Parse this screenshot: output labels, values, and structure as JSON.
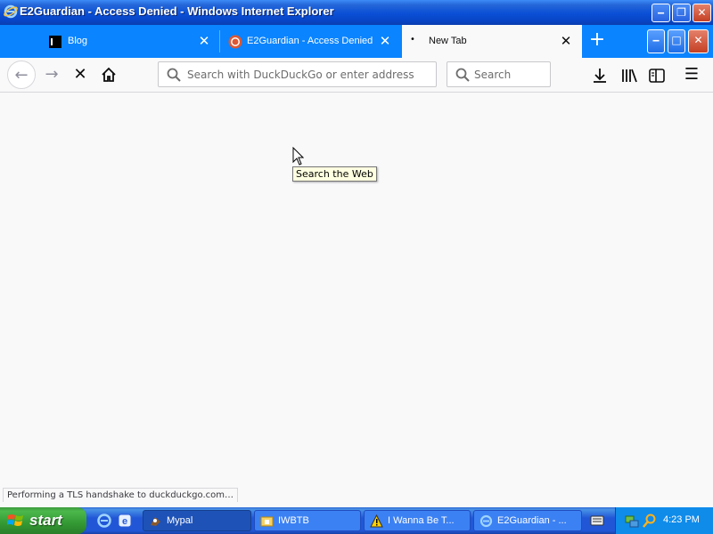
{
  "outer_window": {
    "title": "E2Guardian - Access Denied - Windows Internet Explorer",
    "minimize": "‒",
    "restore": "❐",
    "close": "✕"
  },
  "browser": {
    "tabs": [
      {
        "label": "Blog",
        "active": false
      },
      {
        "label": "E2Guardian - Access Denied",
        "active": false
      },
      {
        "label": "New Tab",
        "active": true
      }
    ],
    "tab_close": "✕",
    "new_tab": "+",
    "controls": {
      "minimize": "‒",
      "maximize": "□",
      "close": "✕"
    }
  },
  "navbar": {
    "back": "←",
    "forward": "→",
    "stop": "✕",
    "url_placeholder": "Search with DuckDuckGo or enter address",
    "search_placeholder": "Search",
    "menu": "☰"
  },
  "content": {
    "tooltip": "Search the Web",
    "status": "Performing a TLS handshake to duckduckgo.com…"
  },
  "taskbar": {
    "start": "start",
    "buttons": [
      {
        "label": "Mypal",
        "pressed": true
      },
      {
        "label": "IWBTB",
        "pressed": false
      },
      {
        "label": "I Wanna Be T...",
        "pressed": false
      },
      {
        "label": "E2Guardian - ...",
        "pressed": false
      }
    ],
    "clock": "4:23 PM"
  },
  "colors": {
    "firefox_blue": "#0a84ff",
    "xp_title_blue": "#0a4fd6",
    "start_green": "#3c9b3c",
    "tooltip_bg": "#ffffe1"
  },
  "icons": {
    "outer": "ie-logo-icon",
    "tab1": "blog-favicon-icon",
    "tab2": "duckduckgo-favicon-icon",
    "nav": [
      "back-arrow-icon",
      "forward-arrow-icon",
      "stop-icon",
      "home-icon",
      "search-icon",
      "download-icon",
      "library-icon",
      "sidebar-icon",
      "hamburger-menu-icon"
    ]
  }
}
